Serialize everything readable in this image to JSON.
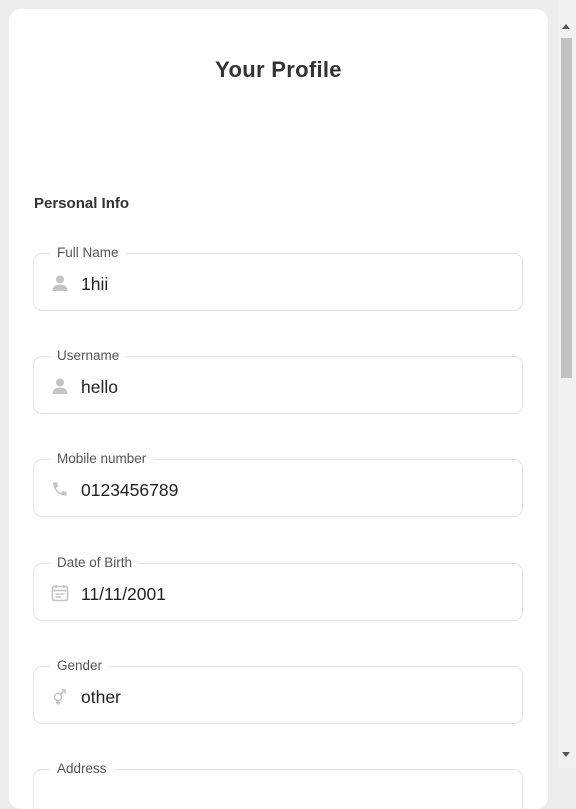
{
  "page": {
    "title": "Your Profile",
    "section_title": "Personal Info"
  },
  "fields": [
    {
      "label": "Full Name",
      "value": "1hii",
      "icon": "person-icon"
    },
    {
      "label": "Username",
      "value": "hello",
      "icon": "person-icon"
    },
    {
      "label": "Mobile number",
      "value": "0123456789",
      "icon": "phone-icon"
    },
    {
      "label": "Date of Birth",
      "value": "11/11/2001",
      "icon": "calendar-icon"
    },
    {
      "label": "Gender",
      "value": "other",
      "icon": "gender-icon"
    },
    {
      "label": "Address",
      "value": "",
      "icon": ""
    }
  ],
  "colors": {
    "icon": "#c4c4c4",
    "border": "#e4e4e4",
    "text": "#333333"
  }
}
